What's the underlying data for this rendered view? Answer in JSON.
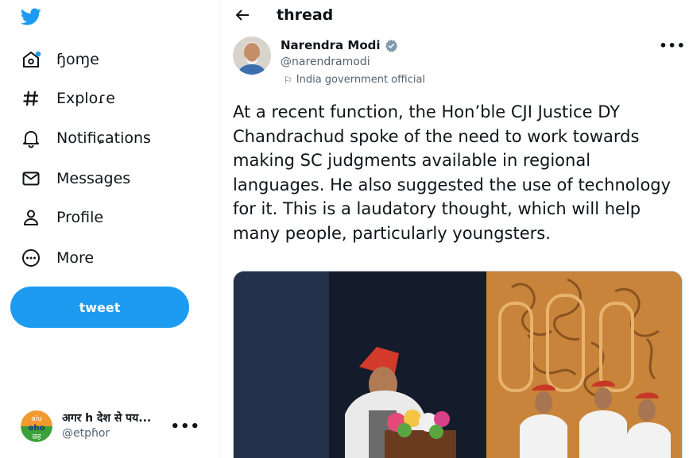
{
  "sidebar": {
    "logo_icon": "twitter-bird-icon",
    "items": [
      {
        "label": "ɧoɱe",
        "icon": "home-icon",
        "has_dot": true
      },
      {
        "label": "Exploɾe",
        "icon": "hash-icon"
      },
      {
        "label": "Notifiɕations",
        "icon": "bell-icon"
      },
      {
        "label": "Messages",
        "icon": "mail-icon"
      },
      {
        "label": "Profile",
        "icon": "person-icon"
      },
      {
        "label": "More",
        "icon": "more-circle-icon"
      }
    ],
    "tweet_button": "tweet",
    "account": {
      "name": "अगर h देश से पय...",
      "handle": "@etpɦor",
      "avatar_text": [
        "aiu",
        "eho",
        "छह"
      ],
      "more": "•••"
    }
  },
  "main": {
    "header": {
      "title": "thread",
      "back_icon": "back-arrow-icon"
    },
    "author": {
      "name": "Narendra Modi",
      "handle": "@narendramodi",
      "label": "India government official",
      "verified_icon": "verified-badge-icon",
      "more": "•••"
    },
    "tweet_text": "At a recent function, the Hon’ble CJI Justice DY Chandrachud spoke of the need to work towards making SC judgments available in regional languages. He also suggested the use of technology for it. This is a laudatory thought, which will help many people, particularly youngsters.",
    "media": {
      "alt_icon": "event-photo-image"
    }
  },
  "colors": {
    "accent": "#1d9bf0",
    "text": "#0f1419",
    "secondary": "#536471"
  }
}
